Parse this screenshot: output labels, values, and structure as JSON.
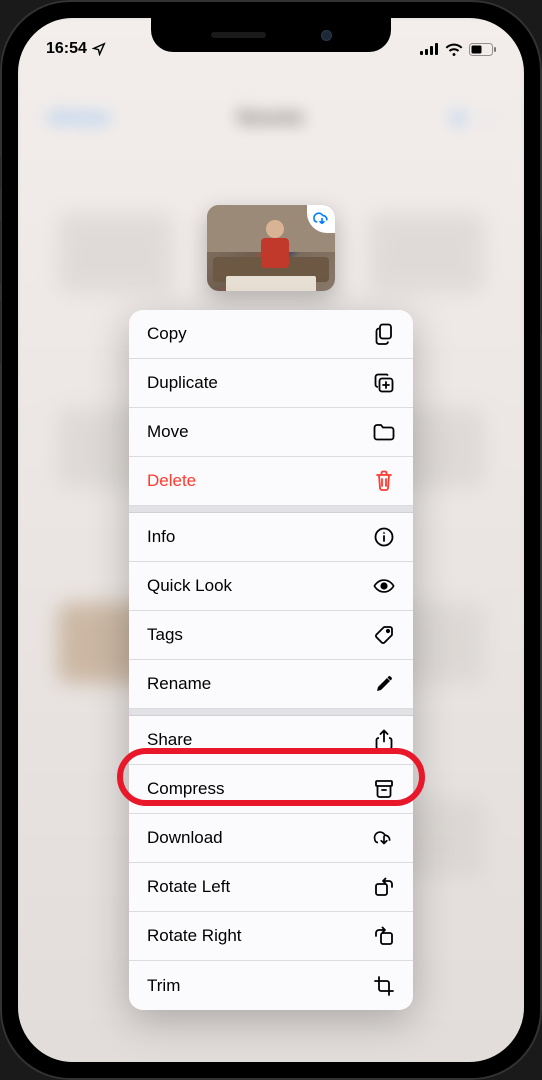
{
  "status": {
    "time": "16:54",
    "location_icon": "location-arrow"
  },
  "thumbnail": {
    "cloud_status": "download-available"
  },
  "menu": {
    "groups": [
      {
        "items": [
          {
            "id": "copy",
            "label": "Copy",
            "icon": "copy-icon",
            "destructive": false
          },
          {
            "id": "duplicate",
            "label": "Duplicate",
            "icon": "duplicate-icon",
            "destructive": false
          },
          {
            "id": "move",
            "label": "Move",
            "icon": "folder-icon",
            "destructive": false
          },
          {
            "id": "delete",
            "label": "Delete",
            "icon": "trash-icon",
            "destructive": true
          }
        ]
      },
      {
        "items": [
          {
            "id": "info",
            "label": "Info",
            "icon": "info-icon",
            "destructive": false
          },
          {
            "id": "quicklook",
            "label": "Quick Look",
            "icon": "eye-icon",
            "destructive": false
          },
          {
            "id": "tags",
            "label": "Tags",
            "icon": "tag-icon",
            "destructive": false
          },
          {
            "id": "rename",
            "label": "Rename",
            "icon": "pencil-icon",
            "destructive": false
          }
        ]
      },
      {
        "items": [
          {
            "id": "share",
            "label": "Share",
            "icon": "share-icon",
            "destructive": false
          },
          {
            "id": "compress",
            "label": "Compress",
            "icon": "archive-icon",
            "destructive": false
          },
          {
            "id": "download",
            "label": "Download",
            "icon": "cloud-download-icon",
            "destructive": false
          },
          {
            "id": "rotateleft",
            "label": "Rotate Left",
            "icon": "rotate-left-icon",
            "destructive": false
          },
          {
            "id": "rotateright",
            "label": "Rotate Right",
            "icon": "rotate-right-icon",
            "destructive": false
          },
          {
            "id": "trim",
            "label": "Trim",
            "icon": "crop-icon",
            "destructive": false
          }
        ]
      }
    ]
  },
  "annotation": {
    "highlighted_item": "compress",
    "color": "#e8172a"
  }
}
